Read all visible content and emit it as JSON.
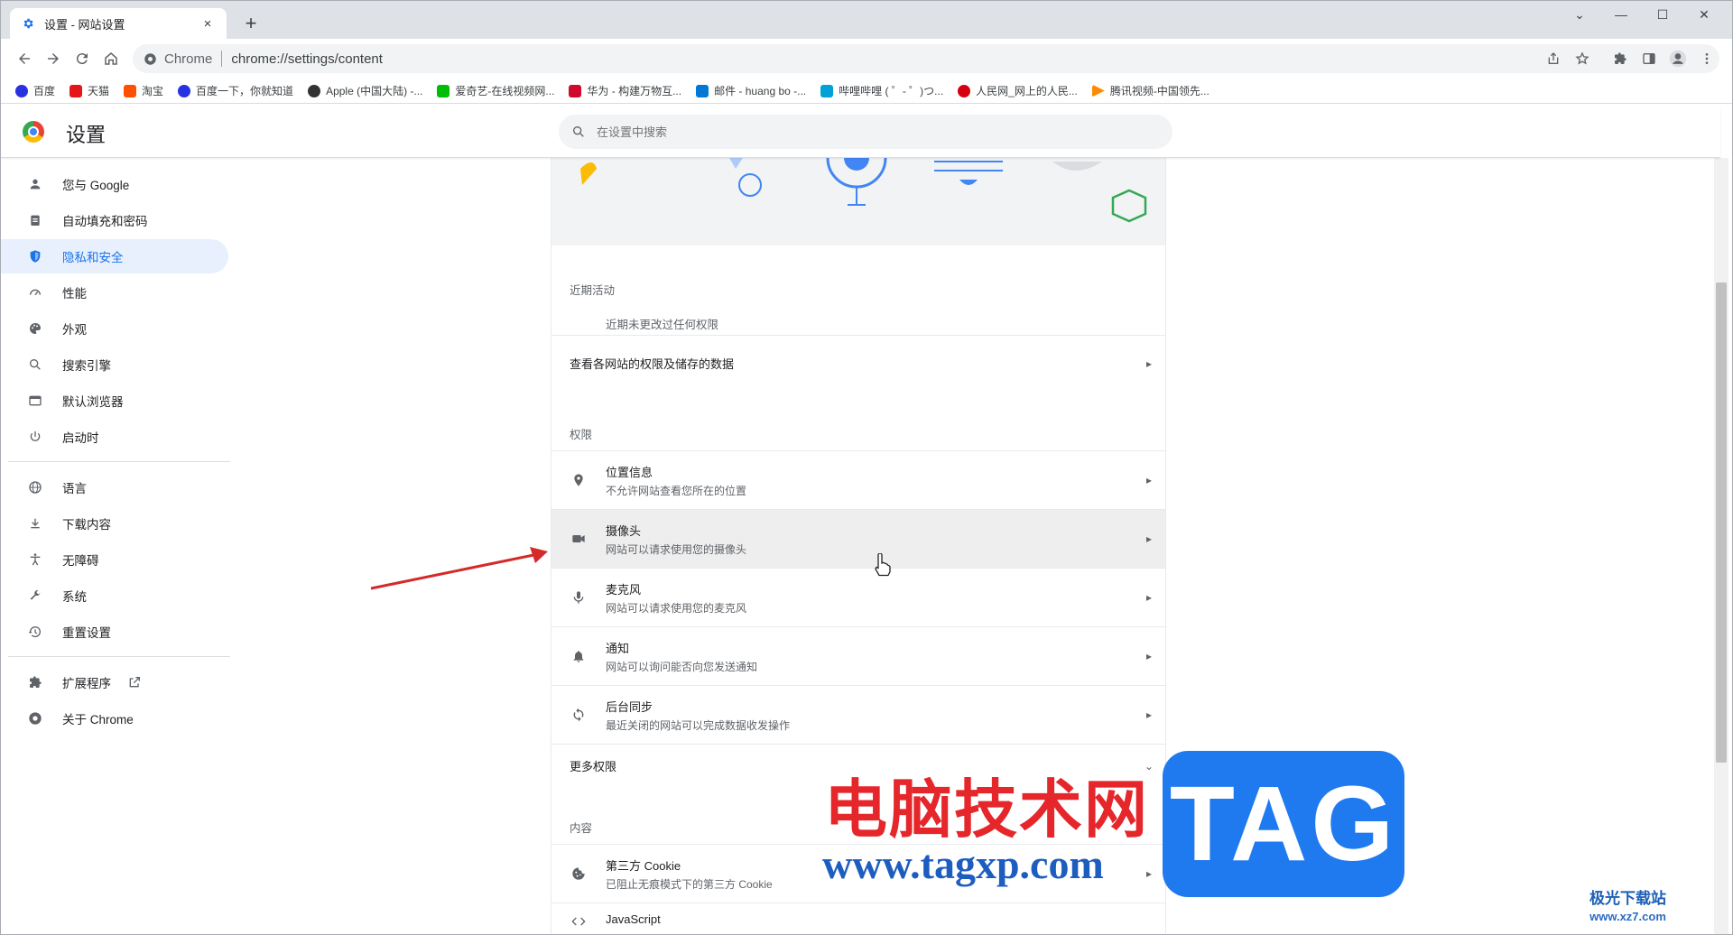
{
  "window": {
    "tab_title": "设置 - 网站设置",
    "new_tab_label": "+",
    "close_label": "×",
    "controls": [
      "⌄",
      "—",
      "☐",
      "✕"
    ]
  },
  "toolbar": {
    "site_chip": "Chrome",
    "url": "chrome://settings/content"
  },
  "bookmarks": [
    {
      "label": "百度",
      "color": "#2932e1"
    },
    {
      "label": "天猫",
      "color": "#e4151b"
    },
    {
      "label": "淘宝",
      "color": "#ff5000"
    },
    {
      "label": "百度一下，你就知道",
      "color": "#2932e1"
    },
    {
      "label": "Apple (中国大陆) -...",
      "color": "#333333"
    },
    {
      "label": "爱奇艺-在线视频网...",
      "color": "#00be06"
    },
    {
      "label": "华为 - 构建万物互...",
      "color": "#cf0a2c"
    },
    {
      "label": "邮件 - huang bo -...",
      "color": "#0078d4"
    },
    {
      "label": "哔哩哔哩 ( ゜- ゜)つ...",
      "color": "#00a1d6"
    },
    {
      "label": "人民网_网上的人民...",
      "color": "#d7000f"
    },
    {
      "label": "腾讯视频-中国领先...",
      "color": "#ff8a00"
    }
  ],
  "header": {
    "title": "设置",
    "search_placeholder": "在设置中搜索"
  },
  "sidebar": {
    "items": [
      {
        "label": "您与 Google",
        "icon": "person-icon"
      },
      {
        "label": "自动填充和密码",
        "icon": "clipboard-icon"
      },
      {
        "label": "隐私和安全",
        "icon": "shield-icon",
        "active": true
      },
      {
        "label": "性能",
        "icon": "gauge-icon"
      },
      {
        "label": "外观",
        "icon": "palette-icon"
      },
      {
        "label": "搜索引擎",
        "icon": "search-icon"
      },
      {
        "label": "默认浏览器",
        "icon": "browser-icon"
      },
      {
        "label": "启动时",
        "icon": "power-icon"
      },
      {
        "label": "语言",
        "icon": "globe-icon"
      },
      {
        "label": "下载内容",
        "icon": "download-icon"
      },
      {
        "label": "无障碍",
        "icon": "accessibility-icon"
      },
      {
        "label": "系统",
        "icon": "wrench-icon"
      },
      {
        "label": "重置设置",
        "icon": "history-icon"
      },
      {
        "label": "扩展程序",
        "icon": "puzzle-icon"
      },
      {
        "label": "关于 Chrome",
        "icon": "chrome-icon"
      }
    ]
  },
  "main": {
    "recent_title": "近期活动",
    "recent_empty": "近期未更改过任何权限",
    "view_all": "查看各网站的权限及储存的数据",
    "permissions_title": "权限",
    "permissions": [
      {
        "label": "位置信息",
        "sub": "不允许网站查看您所在的位置",
        "icon": "location-icon"
      },
      {
        "label": "摄像头",
        "sub": "网站可以请求使用您的摄像头",
        "icon": "camera-icon"
      },
      {
        "label": "麦克风",
        "sub": "网站可以请求使用您的麦克风",
        "icon": "mic-icon"
      },
      {
        "label": "通知",
        "sub": "网站可以询问能否向您发送通知",
        "icon": "bell-icon"
      },
      {
        "label": "后台同步",
        "sub": "最近关闭的网站可以完成数据收发操作",
        "icon": "sync-icon"
      }
    ],
    "more_permissions": "更多权限",
    "content_title": "内容",
    "content": [
      {
        "label": "第三方 Cookie",
        "sub": "已阻止无痕模式下的第三方 Cookie",
        "icon": "cookie-icon"
      },
      {
        "label": "JavaScript",
        "sub": "",
        "icon": "code-icon"
      }
    ]
  },
  "watermark": {
    "cn": "电脑技术网",
    "url": "www.tagxp.com",
    "tag": "TAG",
    "site": "极光下载站",
    "site_url": "www.xz7.com"
  },
  "colors": {
    "accent": "#1a73e8",
    "active_bg": "#e8f0fe",
    "highlight_row": "#eeeeee",
    "annotation_arrow": "#d42a2a"
  }
}
